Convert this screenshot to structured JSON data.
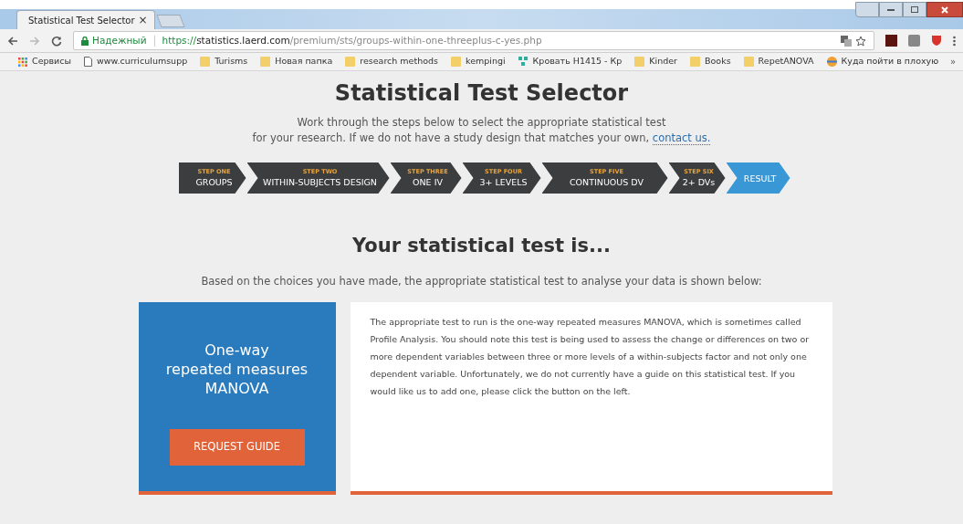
{
  "browser": {
    "tab_title": "Statistical Test Selector",
    "tab_close": "×",
    "secure_label": "Надежный",
    "url": {
      "scheme": "https://",
      "host": "statistics.laerd.com",
      "path": "/premium/sts/groups-within-one-threeplus-c-yes.php"
    },
    "bookmarks": [
      {
        "kind": "apps",
        "label": "Сервисы"
      },
      {
        "kind": "page",
        "label": "www.curriculumsupp"
      },
      {
        "kind": "folder",
        "label": "Turisms"
      },
      {
        "kind": "folder",
        "label": "Новая папка"
      },
      {
        "kind": "folder",
        "label": "research methods"
      },
      {
        "kind": "folder",
        "label": "kempingi"
      },
      {
        "kind": "site",
        "label": "Кровать H1415 - Кр"
      },
      {
        "kind": "folder",
        "label": "Kinder"
      },
      {
        "kind": "folder",
        "label": "Books"
      },
      {
        "kind": "folder",
        "label": "RepetANOVA"
      },
      {
        "kind": "globe",
        "label": "Куда пойти в плохую"
      }
    ],
    "more": "»"
  },
  "page": {
    "title": "Statistical Test Selector",
    "intro_lines": [
      "Work through the steps below to select the appropriate statistical test",
      "for your research. If we do not have a study design that matches your own, "
    ],
    "contact_link": "contact us.",
    "steps": [
      {
        "step": "STEP ONE",
        "label": "GROUPS",
        "selected": false
      },
      {
        "step": "STEP TWO",
        "label": "WITHIN-SUBJECTS DESIGN",
        "selected": false
      },
      {
        "step": "STEP THREE",
        "label": "ONE IV",
        "selected": false
      },
      {
        "step": "STEP FOUR",
        "label": "3+ LEVELS",
        "selected": false
      },
      {
        "step": "STEP FIVE",
        "label": "CONTINUOUS DV",
        "selected": false
      },
      {
        "step": "STEP SIX",
        "label": "2+ DVs",
        "selected": false
      },
      {
        "label": "RESULT",
        "selected": true
      }
    ],
    "result_heading": "Your statistical test is...",
    "result_intro": "Based on the choices you have made, the appropriate statistical test to analyse your data is shown below:",
    "test_name_lines": [
      "One-way",
      "repeated measures",
      "MANOVA"
    ],
    "request_button": "REQUEST GUIDE",
    "description": "The appropriate test to run is the one-way repeated measures MANOVA, which is sometimes called Profile Analysis. You should note this test is being used to assess the change or differences on two or more dependent variables between three or more levels of a within-subjects factor and not only one dependent variable. Unfortunately, we do not currently have a guide on this statistical test. If you would like us to add one, please click the button on the left."
  }
}
